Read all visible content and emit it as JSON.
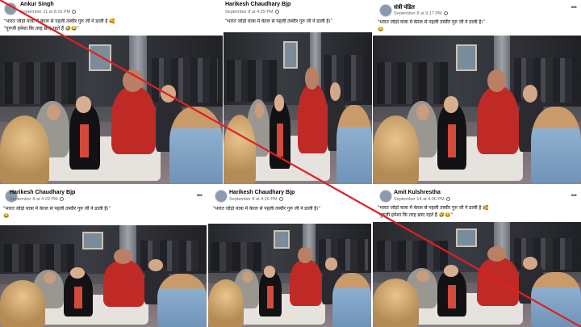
{
  "posts": [
    {
      "author": "Ankur Singh",
      "timestamp": "September 11 at 8:15 PM",
      "caption_line1": "\"भारत जोड़ो यात्रा में केरल से पहली तस्वीर गुरु जी ने डाली है 🥰",
      "caption_line2": "\"गुरुजी हमेशा कि तरह छाए रहते हैं 🤣😂\"",
      "show_more": false
    },
    {
      "author": "Harikesh Chaudhary Bjp",
      "timestamp": "September 8 at 4:29 PM",
      "caption_line1": "\"भारत जोड़ो यात्रा में केरल से पहली तस्वीर गुरु जी ने डाली है।\"",
      "caption_line2": "",
      "show_more": false
    },
    {
      "author": "संत्री पंडित",
      "timestamp": "September 8 at 9:17 PM",
      "caption_line1": "\"भारत जोड़ो यात्रा में केरल से पहली तस्वीर गुरु जी ने डाली है।\"",
      "caption_line2": "😂",
      "show_more": true
    },
    {
      "author": "Harikesh Chaudhary Bjp",
      "timestamp": "September 8 at 4:29 PM",
      "caption_line1": "\"भारत जोड़ो यात्रा में केरल से पहली तस्वीर गुरु जी ने डाली है।\"",
      "caption_line2": "😂",
      "show_more": true
    },
    {
      "author": "Harikesh Chaudhary Bjp",
      "timestamp": "September 8 at 4:29 PM",
      "caption_line1": "\"भारत जोड़ो यात्रा में केरल से पहली तस्वीर गुरु जी ने डाली है।\"",
      "caption_line2": "",
      "show_more": false
    },
    {
      "author": "Amit Kulshrestha",
      "timestamp": "September 14 at 4:06 PM",
      "caption_line1": "\"भारत जोड़ो यात्रा में केरल से पहली तस्वीर गुरु जी ने डाली है 🥰",
      "caption_line2": "\"गुरुजी हमेशा कि तरह छाए रहते हैं 🤣😂\"",
      "show_more": true
    }
  ],
  "icons": {
    "more": "more-options-icon",
    "audience": "globe-icon"
  },
  "colors": {
    "strike": "#e02020",
    "author_text": "#050505",
    "meta_text": "#65676b"
  }
}
